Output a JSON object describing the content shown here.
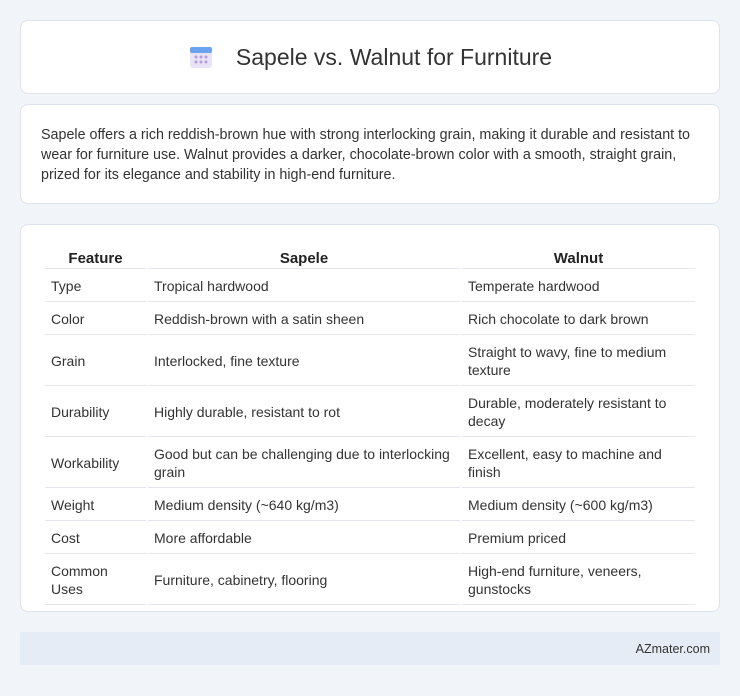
{
  "header": {
    "title": "Sapele vs. Walnut for Furniture",
    "icon": "calendar-icon"
  },
  "summary": {
    "text": "Sapele offers a rich reddish-brown hue with strong interlocking grain, making it durable and resistant to wear for furniture use. Walnut provides a darker, chocolate-brown color with a smooth, straight grain, prized for its elegance and stability in high-end furniture."
  },
  "table": {
    "headers": [
      "Feature",
      "Sapele",
      "Walnut"
    ],
    "rows": [
      [
        "Type",
        "Tropical hardwood",
        "Temperate hardwood"
      ],
      [
        "Color",
        "Reddish-brown with a satin sheen",
        "Rich chocolate to dark brown"
      ],
      [
        "Grain",
        "Interlocked, fine texture",
        "Straight to wavy, fine to medium texture"
      ],
      [
        "Durability",
        "Highly durable, resistant to rot",
        "Durable, moderately resistant to decay"
      ],
      [
        "Workability",
        "Good but can be challenging due to interlocking grain",
        "Excellent, easy to machine and finish"
      ],
      [
        "Weight",
        "Medium density (~640 kg/m3)",
        "Medium density (~600 kg/m3)"
      ],
      [
        "Cost",
        "More affordable",
        "Premium priced"
      ],
      [
        "Common Uses",
        "Furniture, cabinetry, flooring",
        "High-end furniture, veneers, gunstocks"
      ]
    ]
  },
  "footer": {
    "text": "AZmater.com"
  },
  "colors": {
    "icon_top": "#6aa3ee",
    "icon_body": "#e9e3f7",
    "icon_dots": "#b49be0"
  }
}
